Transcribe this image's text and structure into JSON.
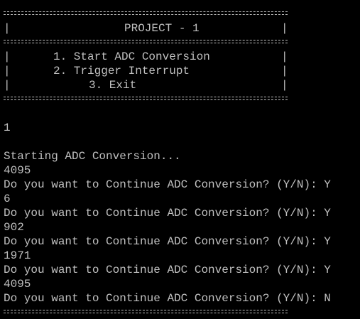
{
  "menu": {
    "title": "PROJECT - 1",
    "items": [
      {
        "label": "1. Start ADC Conversion"
      },
      {
        "label": "2. Trigger Interrupt"
      },
      {
        "label": "3. Exit"
      }
    ]
  },
  "session": {
    "selection": "1",
    "status": "Starting ADC Conversion...",
    "readings": [
      "4095",
      "6",
      "902",
      "1971",
      "4095"
    ],
    "prompt": "Do you want to Continue ADC Conversion? (Y/N):",
    "answers": [
      "Y",
      "Y",
      "Y",
      "Y",
      "N"
    ]
  }
}
